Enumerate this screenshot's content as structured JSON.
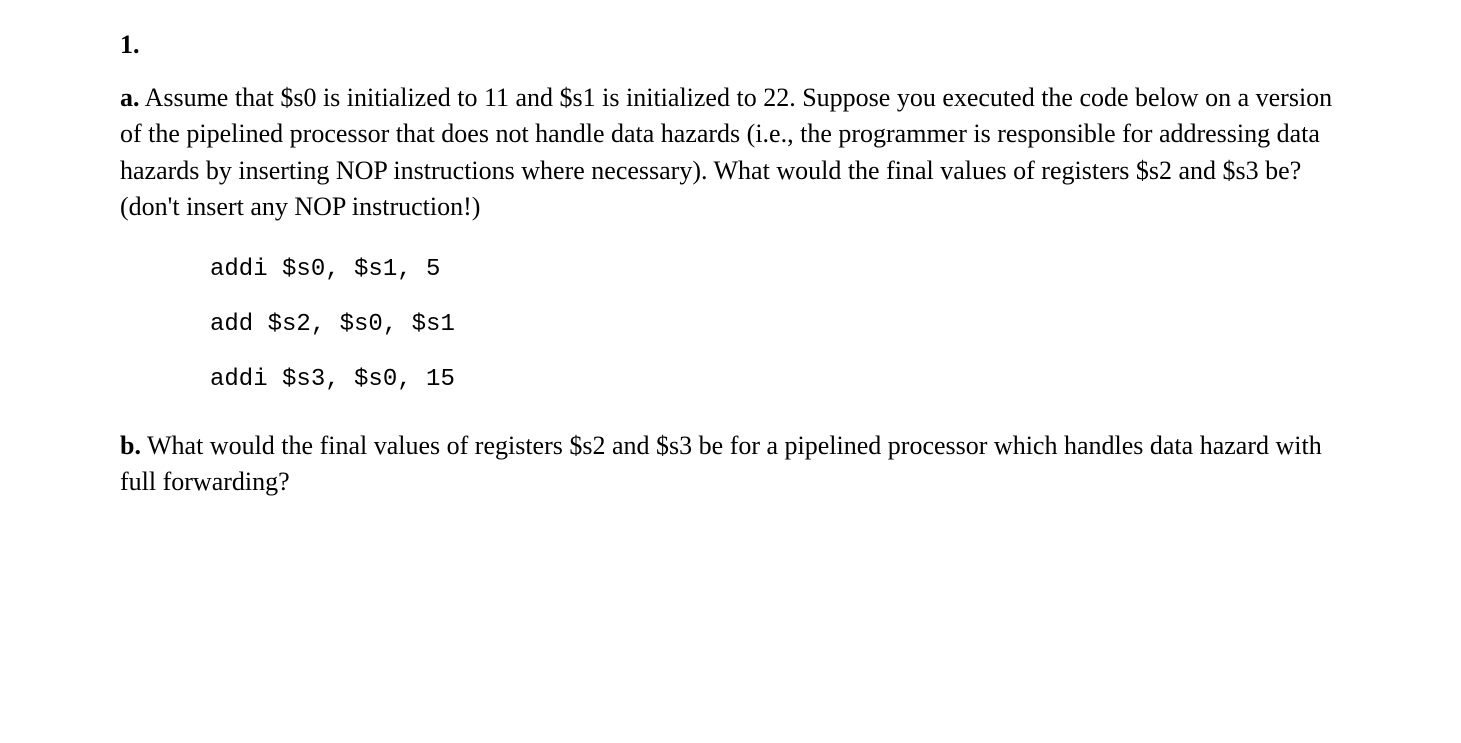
{
  "question": {
    "number": "1.",
    "partA": {
      "label": "a.",
      "text": " Assume that $s0 is initialized to 11 and $s1 is initialized to 22. Suppose you executed the code below on a version of the pipelined processor that does not handle data hazards (i.e., the programmer is responsible for addressing data hazards by inserting NOP instructions where necessary). What would the final values of registers $s2 and $s3 be? (don't insert any NOP instruction!)"
    },
    "code": {
      "line1": "addi $s0, $s1, 5",
      "line2": "add $s2, $s0, $s1",
      "line3": "addi $s3, $s0, 15"
    },
    "partB": {
      "label": "b.",
      "text": " What would the final values of registers $s2 and $s3 be for a pipelined processor which handles data hazard with full forwarding?"
    }
  }
}
